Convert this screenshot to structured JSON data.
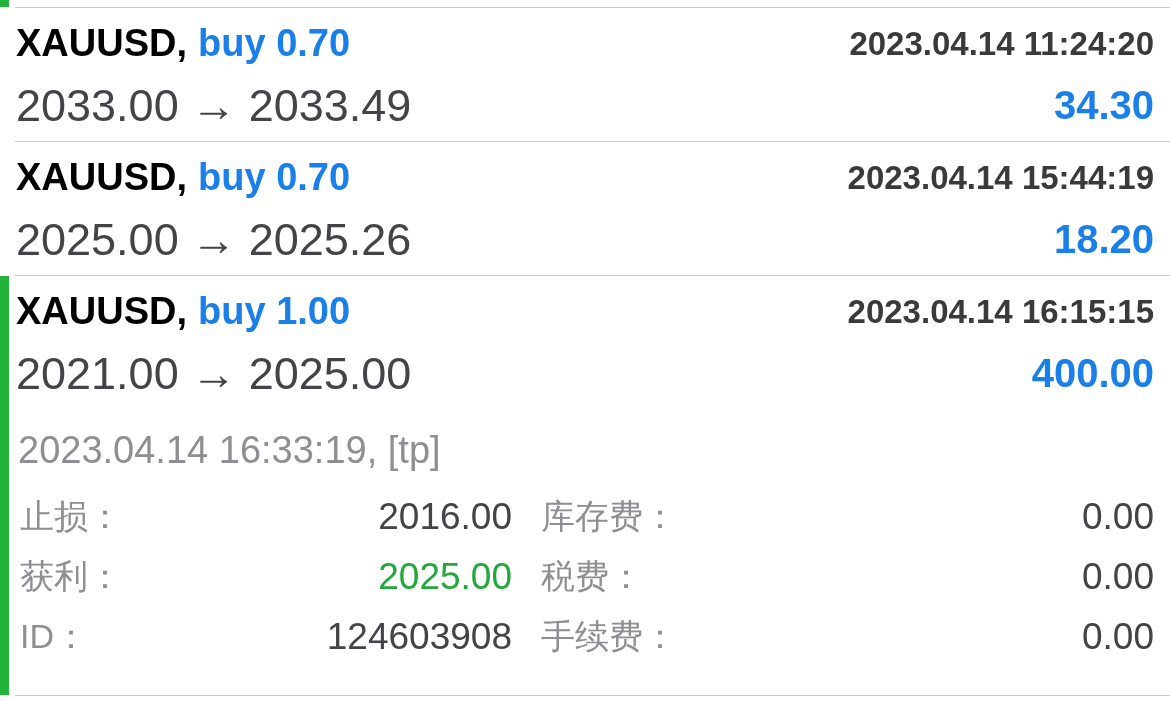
{
  "trade_above": {
    "expanded": true
  },
  "trades": [
    {
      "symbol": "XAUUSD,",
      "order": "buy 0.70",
      "open_time": "2023.04.14 11:24:20",
      "prices": "2033.00 → 2033.49",
      "profit": "34.30",
      "expanded": false
    },
    {
      "symbol": "XAUUSD,",
      "order": "buy 0.70",
      "open_time": "2023.04.14 15:44:19",
      "prices": "2025.00 → 2025.26",
      "profit": "18.20",
      "expanded": false
    },
    {
      "symbol": "XAUUSD,",
      "order": "buy 1.00",
      "open_time": "2023.04.14 16:15:15",
      "prices": "2021.00 → 2025.00",
      "profit": "400.00",
      "expanded": true,
      "close_info": "2023.04.14 16:33:19, [tp]",
      "details": [
        {
          "label": "止损：",
          "value": "2016.00",
          "color": "#444448"
        },
        {
          "label": "库存费：",
          "value": "0.00",
          "color": "#444448"
        },
        {
          "label": "获利：",
          "value": "2025.00",
          "color": "#23a83c"
        },
        {
          "label": "税费：",
          "value": "0.00",
          "color": "#444448"
        },
        {
          "label": "ID：",
          "value": "124603908",
          "color": "#444448"
        },
        {
          "label": "手续费：",
          "value": "0.00",
          "color": "#444448"
        }
      ]
    }
  ]
}
